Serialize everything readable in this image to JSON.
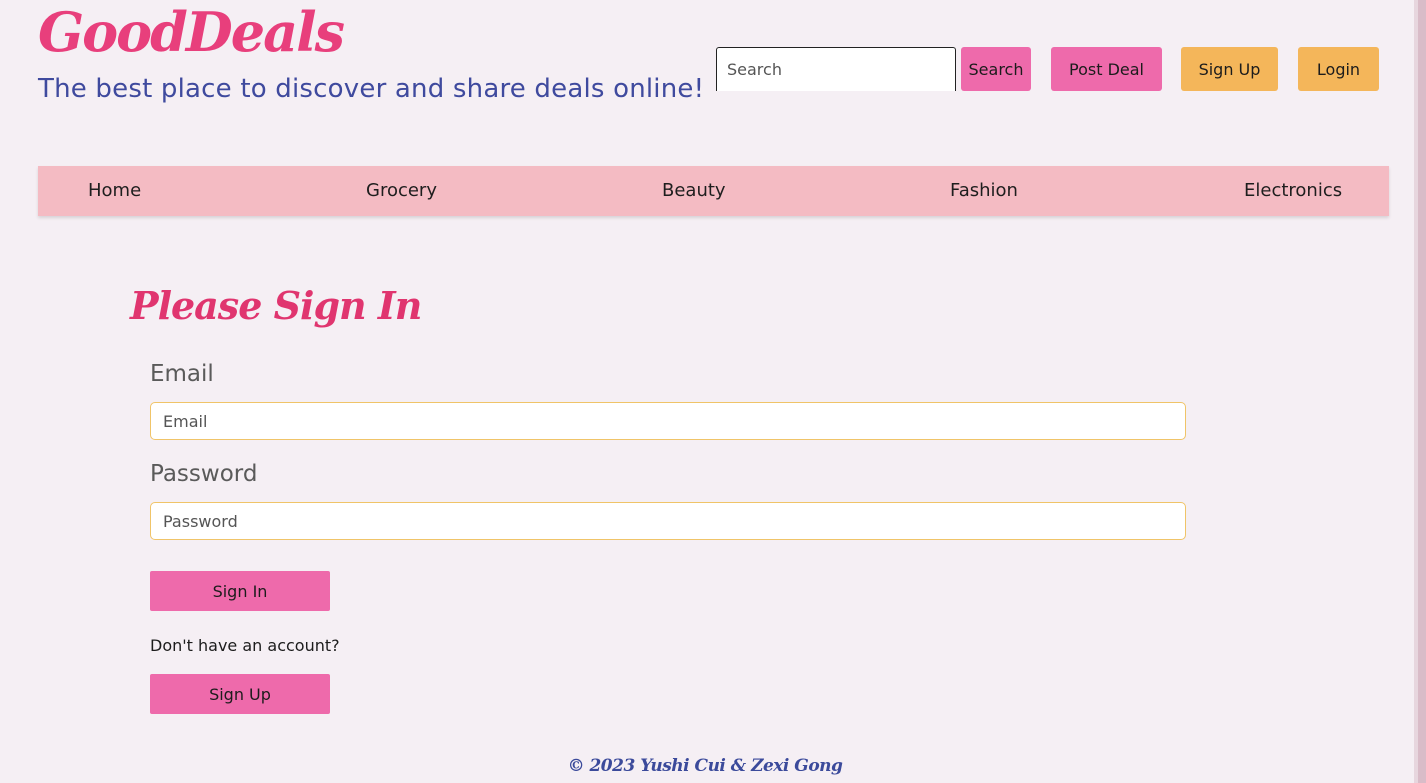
{
  "header": {
    "brand": "GoodDeals",
    "tagline": "The best place to discover and share deals online!",
    "search_placeholder": "Search",
    "search_label": "Search",
    "post_deal_label": "Post Deal",
    "sign_up_label": "Sign Up",
    "login_label": "Login"
  },
  "nav": {
    "items": [
      {
        "label": "Home"
      },
      {
        "label": "Grocery"
      },
      {
        "label": "Beauty"
      },
      {
        "label": "Fashion"
      },
      {
        "label": "Electronics"
      }
    ]
  },
  "main": {
    "heading": "Please Sign In",
    "email_label": "Email",
    "email_placeholder": "Email",
    "password_label": "Password",
    "password_placeholder": "Password",
    "sign_in_label": "Sign In",
    "no_account_text": "Don't have an account?",
    "sign_up_label": "Sign Up"
  },
  "footer": {
    "text": "© 2023 Yushi Cui & Zexi Gong"
  },
  "colors": {
    "background": "#f5eff4",
    "brand_pink": "#e83f7c",
    "tagline_blue": "#3f4a9e",
    "button_pink": "#ee6aab",
    "button_orange": "#f4b65a",
    "nav_bg": "#f4bbc3",
    "field_border": "#f0c468"
  }
}
